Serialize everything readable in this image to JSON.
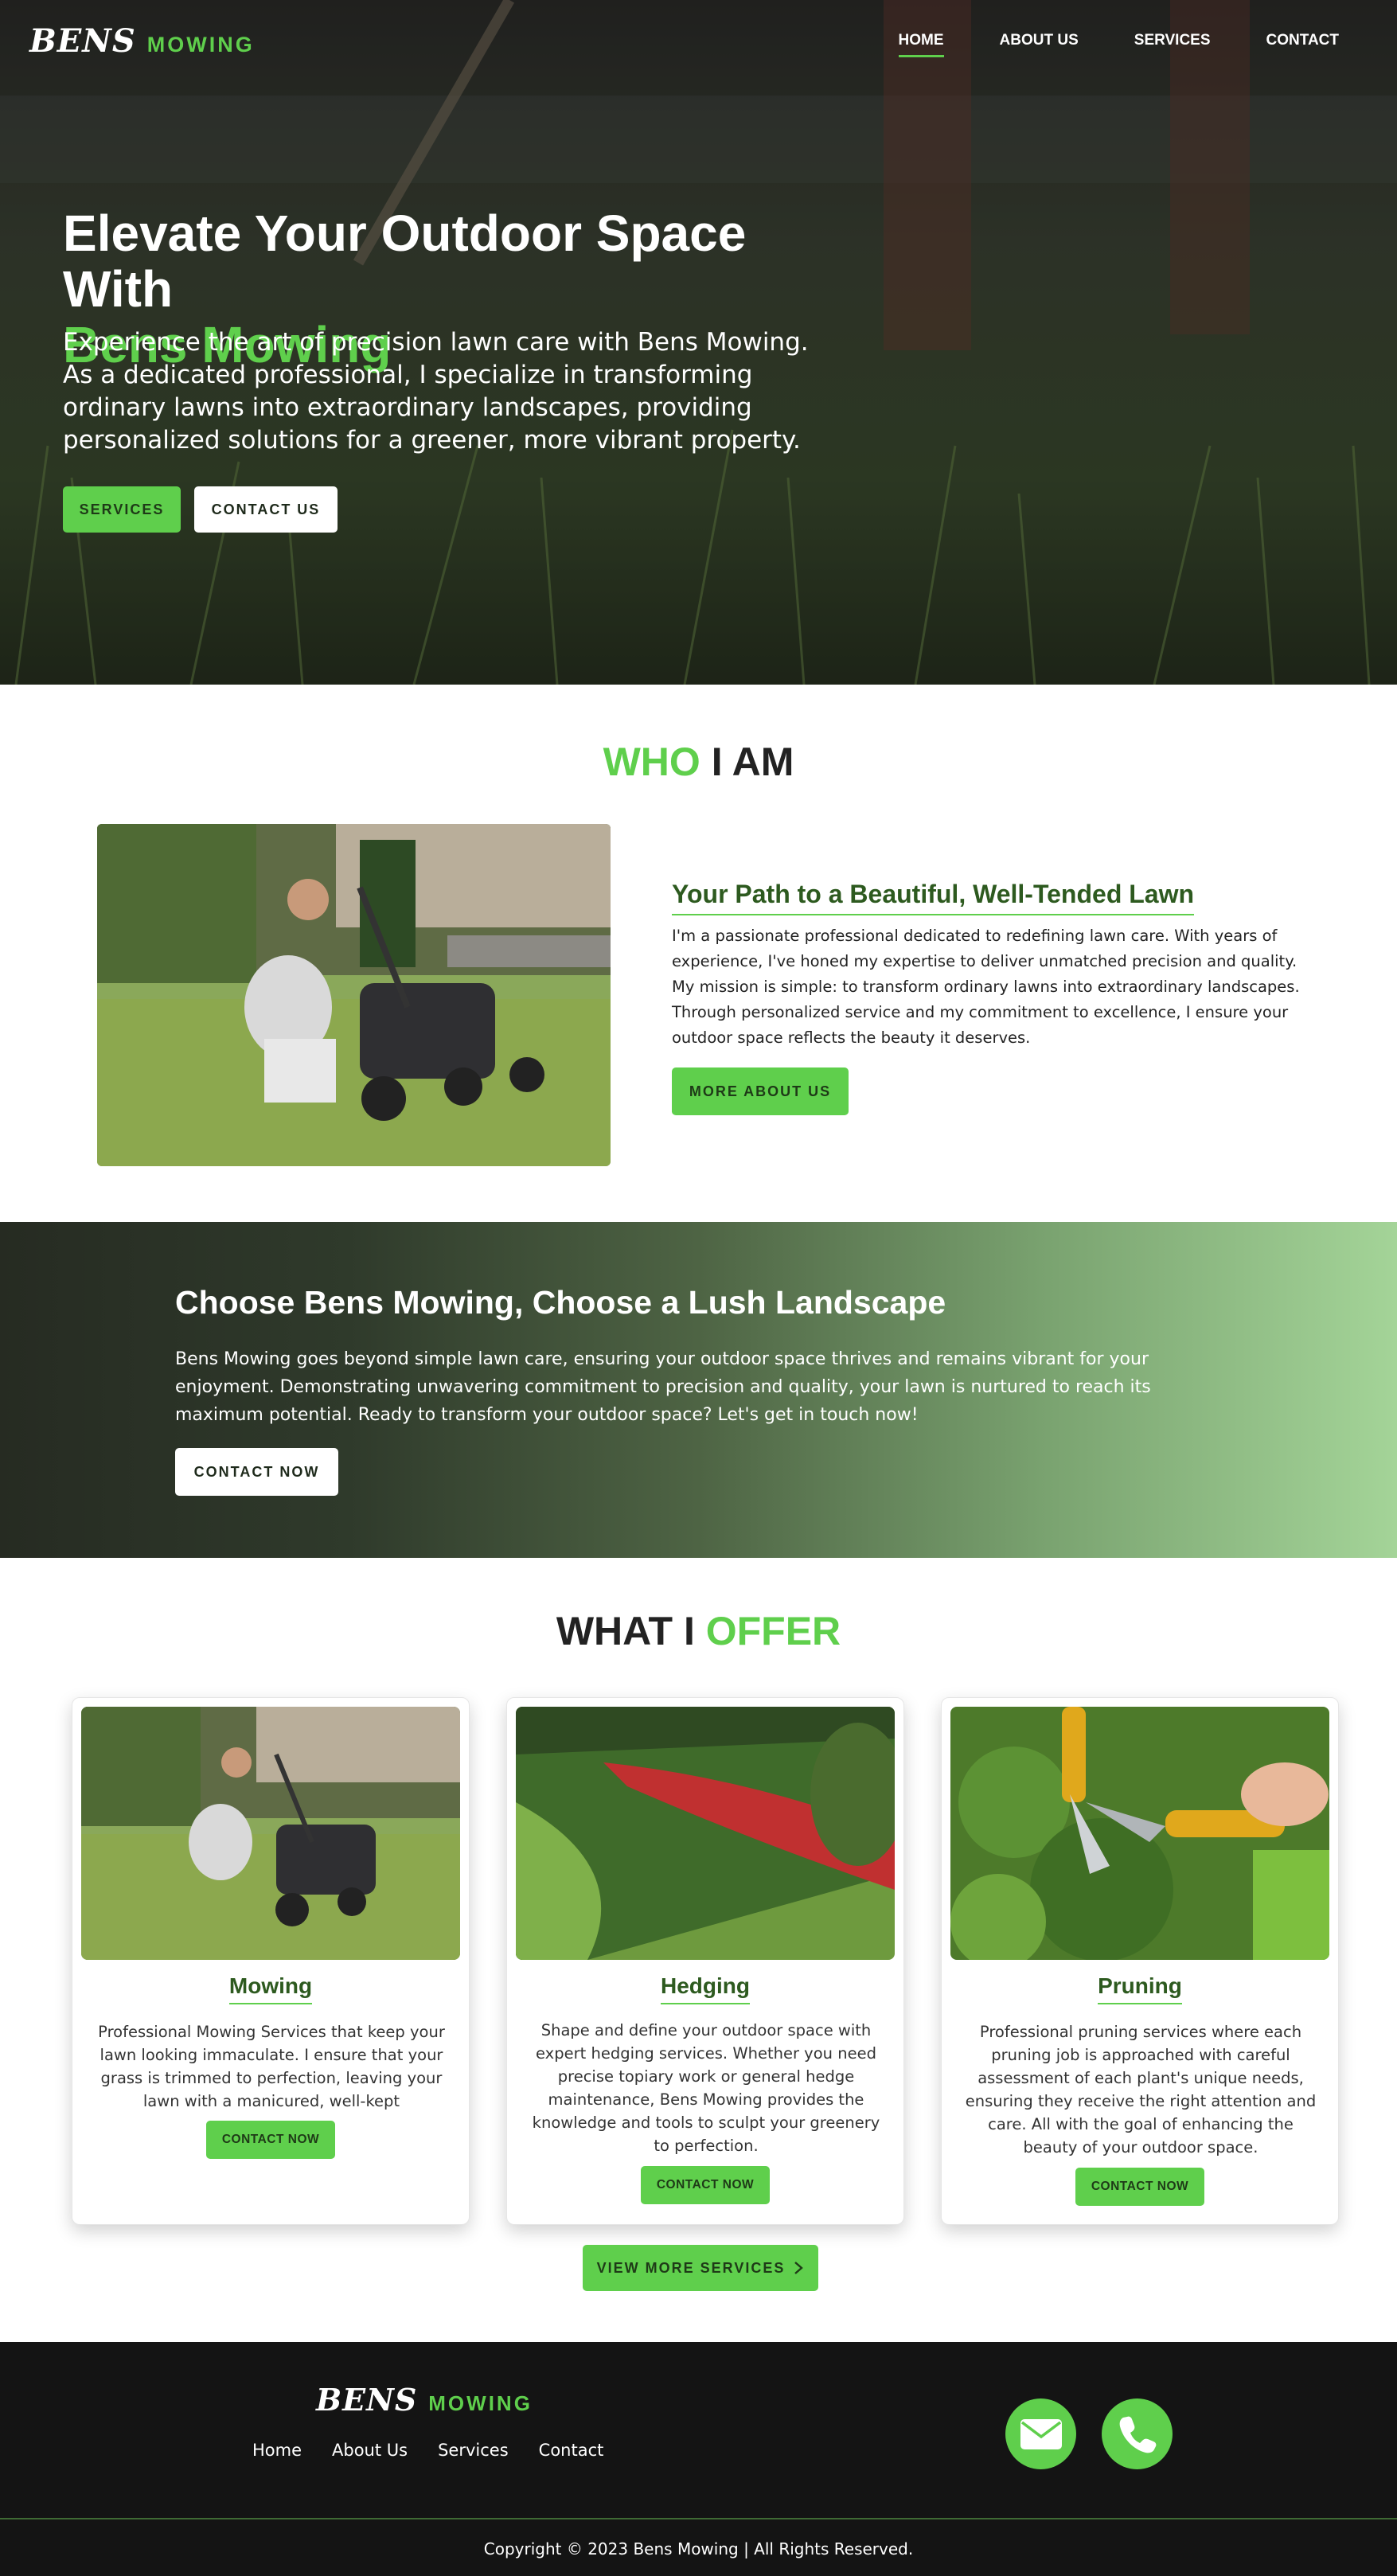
{
  "brand": {
    "script": "BENS",
    "word": "MOWING"
  },
  "nav": {
    "items": [
      {
        "label": "HOME",
        "active": true
      },
      {
        "label": "ABOUT US",
        "active": false
      },
      {
        "label": "SERVICES",
        "active": false
      },
      {
        "label": "CONTACT",
        "active": false
      }
    ]
  },
  "hero": {
    "title_line1": "Elevate Your Outdoor Space With",
    "title_line2": "Bens Mowing",
    "text": "Experience the art of precision lawn care with Bens Mowing. As a dedicated professional, I specialize in transforming ordinary lawns into extraordinary landscapes, providing personalized solutions for a greener, more vibrant property.",
    "button_primary": "SERVICES",
    "button_secondary": "CONTACT US"
  },
  "about": {
    "title_green": "WHO",
    "title_dark": " I AM",
    "heading": "Your Path to a Beautiful, Well-Tended Lawn",
    "text": "I'm a passionate professional dedicated to redefining lawn care. With years of experience, I've honed my expertise to deliver unmatched precision and quality. My mission is simple: to transform ordinary lawns into extraordinary landscapes. Through personalized service and my commitment to excellence, I ensure your outdoor space reflects the beauty it deserves.",
    "button": "MORE ABOUT US"
  },
  "cta": {
    "title": "Choose Bens Mowing, Choose a Lush Landscape",
    "text": "Bens Mowing goes beyond simple lawn care, ensuring your outdoor space thrives and remains vibrant for your enjoyment. Demonstrating unwavering commitment to precision and quality, your lawn is nurtured to reach its maximum potential. Ready to transform your outdoor space? Let's get in touch now!",
    "button": "CONTACT NOW"
  },
  "services": {
    "title_dark": "WHAT I ",
    "title_green": "OFFER",
    "cards": [
      {
        "title": "Mowing",
        "text": "Professional Mowing Services that keep your lawn looking immaculate. I ensure that your grass is trimmed to perfection, leaving your lawn with a manicured, well-kept appearance.",
        "button": "CONTACT NOW"
      },
      {
        "title": "Hedging",
        "text": "Shape and define your outdoor space with expert hedging services. Whether you need precise topiary work or general hedge maintenance, Bens Mowing provides the knowledge and tools to sculpt your greenery to perfection.",
        "button": "CONTACT NOW"
      },
      {
        "title": "Pruning",
        "text": "Professional pruning services where each pruning job is approached with careful assessment of each plant's unique needs, ensuring they receive the right attention and care. All with the goal of enhancing the beauty of your outdoor space.",
        "button": "CONTACT NOW"
      }
    ],
    "more_button": "VIEW MORE SERVICES"
  },
  "footer": {
    "links": [
      "Home",
      "About Us",
      "Services",
      "Contact"
    ],
    "copyright": "Copyright © 2023 Bens Mowing | All Rights Reserved."
  },
  "colors": {
    "accent": "#5fcf4c",
    "dark_green": "#2d5a1f",
    "footer_bg": "#141414"
  },
  "icons": [
    "envelope-icon",
    "phone-icon",
    "chevron-right-icon"
  ]
}
